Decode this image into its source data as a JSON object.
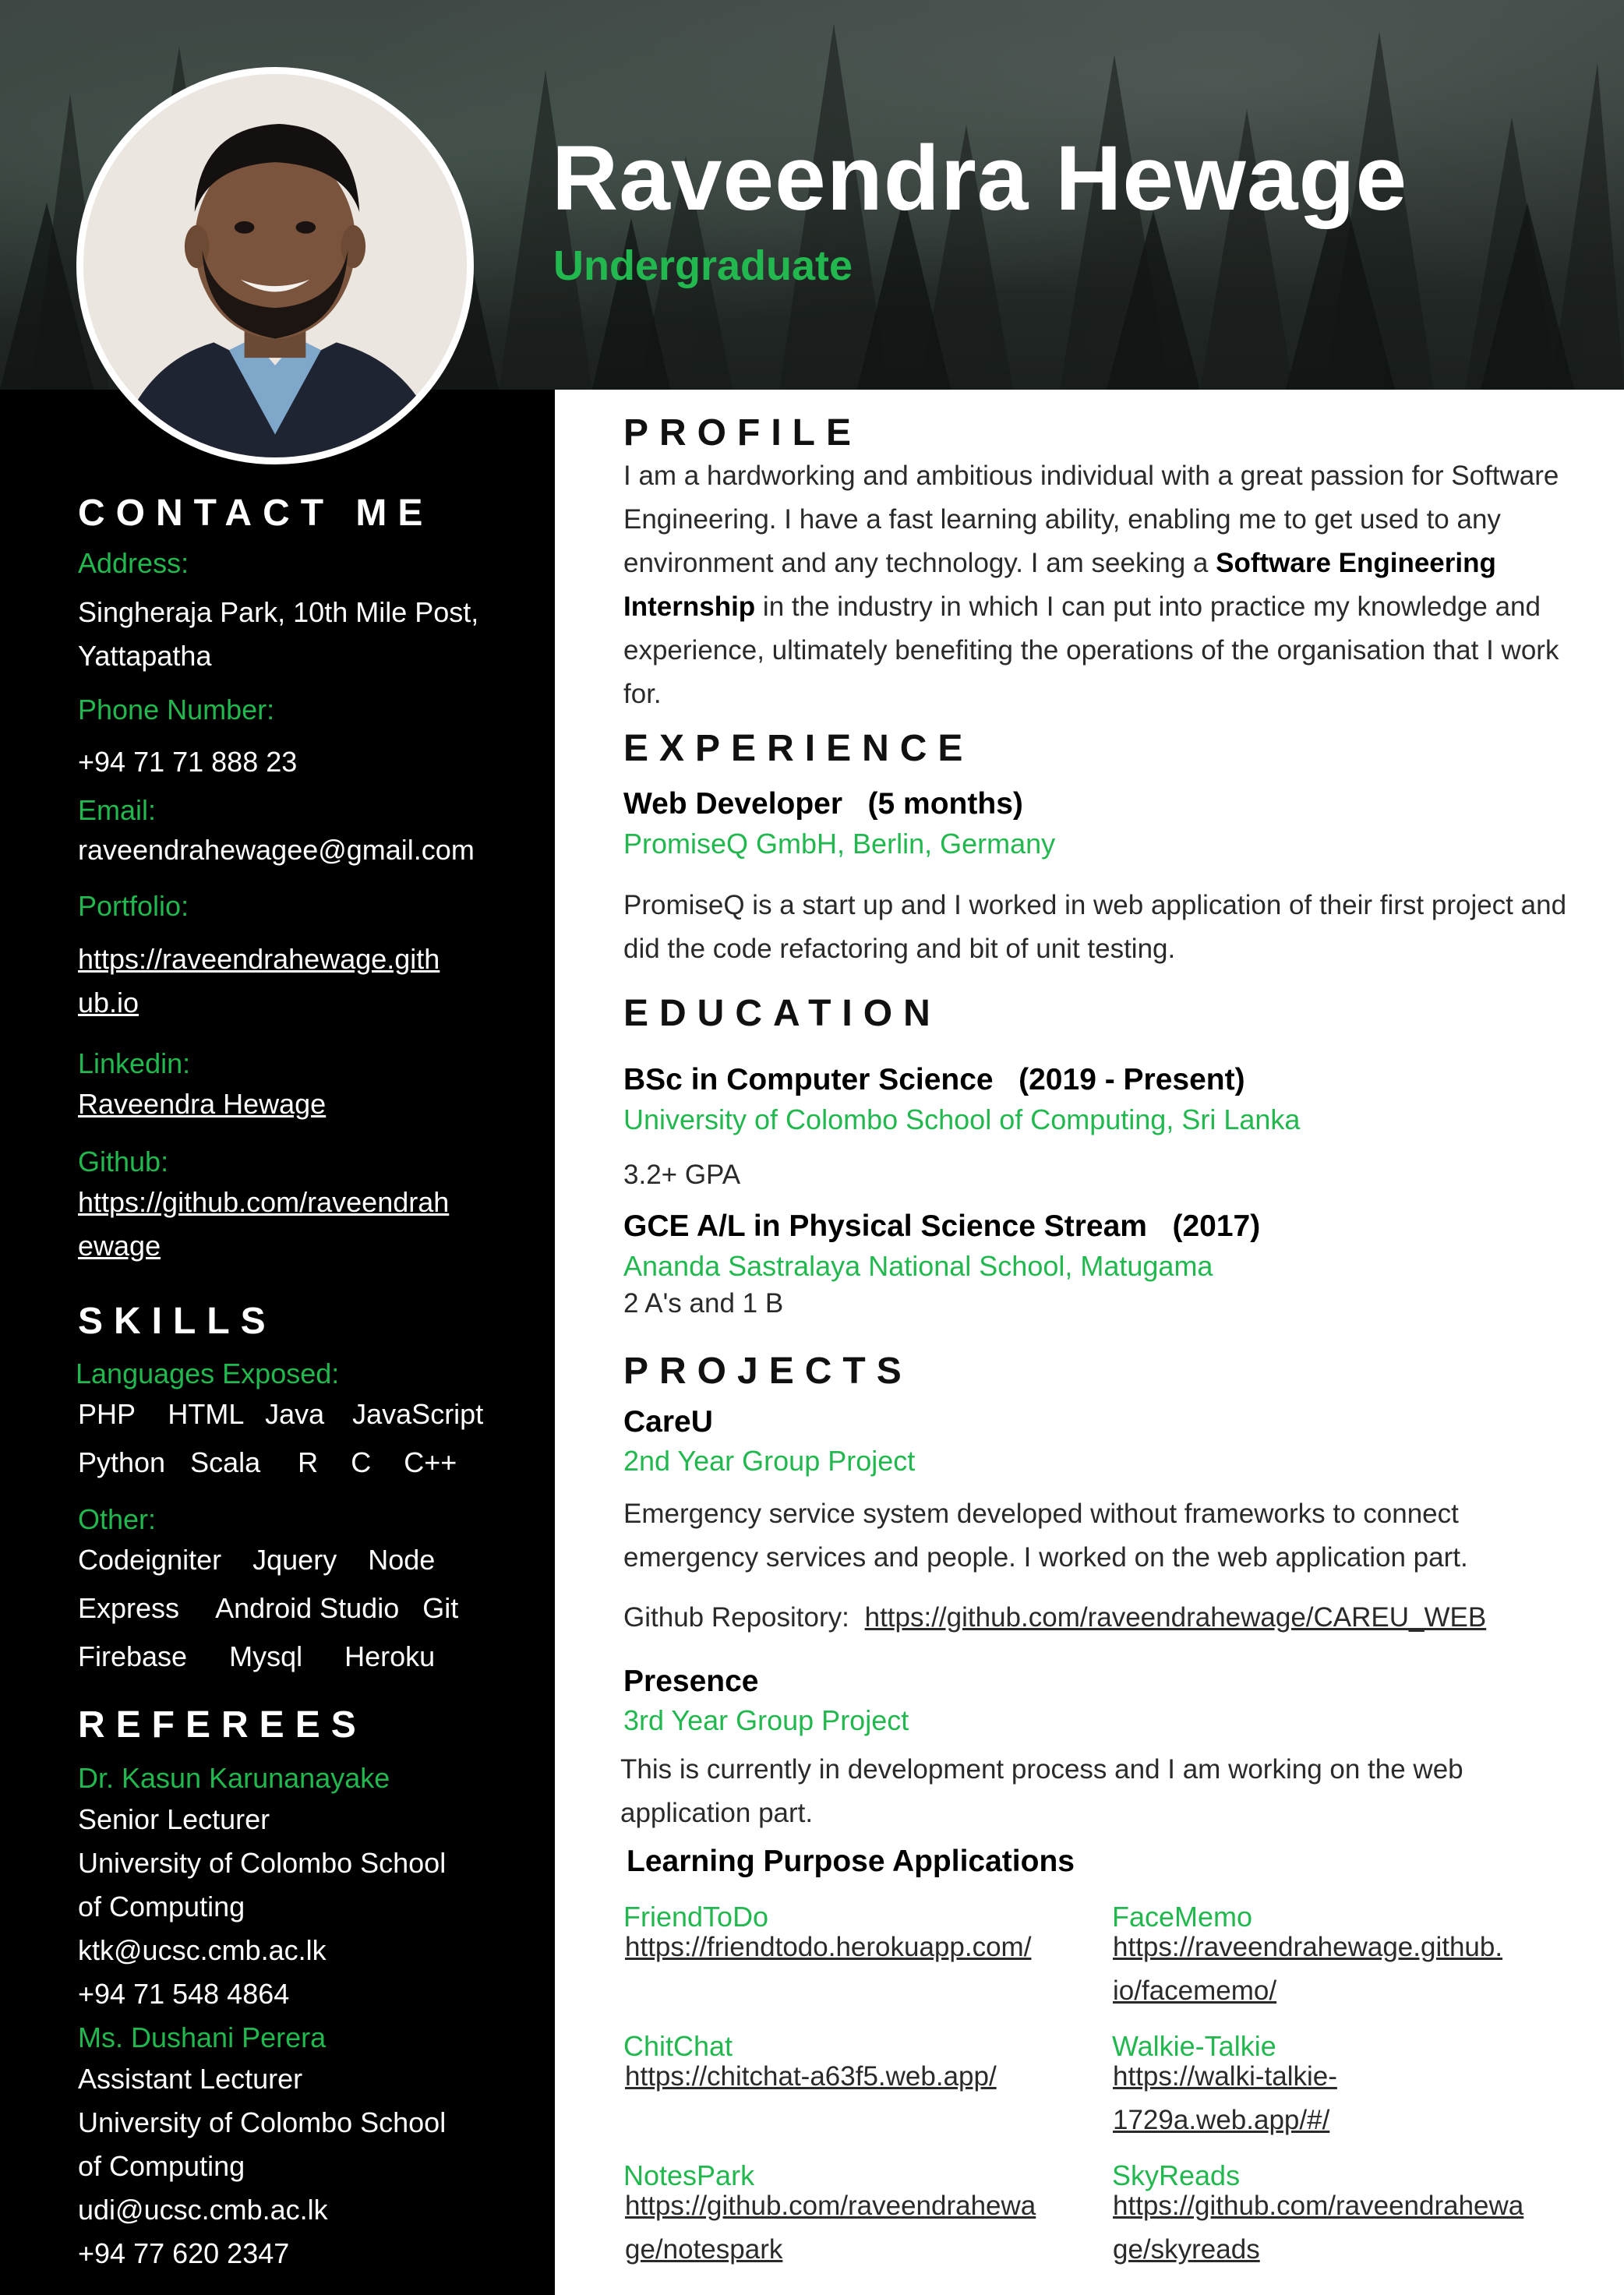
{
  "header": {
    "name": "Raveendra Hewage",
    "role": "Undergraduate"
  },
  "colors": {
    "accent": "#22b84f",
    "sidebar": "#000000",
    "header": "#2a312e"
  },
  "contact": {
    "heading": "CONTACT ME",
    "address_label": "Address:",
    "address_lines": [
      "Singheraja Park, 10th Mile Post,",
      "Yattapatha"
    ],
    "phone_label": "Phone Number:",
    "phone": "+94 71 71 888 23",
    "email_label": "Email:",
    "email": "raveendrahewagee@gmail.com",
    "portfolio_label": "Portfolio:",
    "portfolio_lines": [
      "https://raveendrahewage.gith",
      "ub.io"
    ],
    "linkedin_label": "Linkedin:",
    "linkedin": "Raveendra Hewage",
    "github_label": "Github:",
    "github_lines": [
      "https://github.com/raveendrah",
      "ewage"
    ]
  },
  "skills": {
    "heading": "SKILLS",
    "languages_label": "Languages Exposed:",
    "languages_row1": [
      "PHP",
      "HTML",
      "Java",
      "JavaScript"
    ],
    "languages_row2": [
      "Python",
      "Scala",
      "R",
      "C",
      "C++"
    ],
    "other_label": "Other:",
    "other_row1": [
      "Codeigniter",
      "Jquery",
      "Node"
    ],
    "other_row2": [
      "Express",
      "Android Studio",
      "Git"
    ],
    "other_row3": [
      "Firebase",
      "Mysql",
      "Heroku"
    ]
  },
  "referees": {
    "heading": "REFEREES",
    "items": [
      {
        "name": "Dr. Kasun Karunanayake",
        "lines": [
          "Senior Lecturer",
          "University of Colombo School",
          "of Computing",
          "ktk@ucsc.cmb.ac.lk",
          "+94 71 548 4864"
        ]
      },
      {
        "name": "Ms. Dushani Perera",
        "lines": [
          "Assistant Lecturer",
          "University of Colombo School",
          "of Computing",
          "udi@ucsc.cmb.ac.lk",
          "+94 77 620 2347"
        ]
      }
    ]
  },
  "profile": {
    "heading": "PROFILE",
    "text_before": "I am a hardworking and ambitious individual with a great passion for Software Engineering. I have a fast learning ability, enabling me to get used to any environment and any technology. I am seeking a ",
    "highlight": "Software Engineering Internship",
    "text_after": " in the industry in which I can put into practice my knowledge and experience, ultimately benefiting the operations of the organisation that I work for."
  },
  "experience": {
    "heading": "EXPERIENCE",
    "title": "Web Developer   (5 months)",
    "company": "PromiseQ GmbH, Berlin, Germany",
    "description": "PromiseQ is a start up and I worked in web application of their first project and did the code refactoring and bit of unit testing."
  },
  "education": {
    "heading": "EDUCATION",
    "items": [
      {
        "title": "BSc in Computer Science   (2019 - Present)",
        "school": "University of Colombo School of Computing, Sri Lanka",
        "detail": "3.2+ GPA"
      },
      {
        "title": "GCE A/L in Physical Science Stream   (2017)",
        "school": "Ananda Sastralaya National School, Matugama",
        "detail": "2 A's and 1 B"
      }
    ]
  },
  "projects": {
    "heading": "PROJECTS",
    "careu": {
      "title": "CareU",
      "subtitle": "2nd Year Group Project",
      "description": "Emergency service system developed without frameworks to connect emergency services and people. I worked on the web application part.",
      "repo_label": "Github Repository:",
      "repo_link": "https://github.com/raveendrahewage/CAREU_WEB"
    },
    "presence": {
      "title": "Presence",
      "subtitle": "3rd Year Group Project",
      "description": "This is currently in development process and I am working on the web application part."
    },
    "learning_heading": "Learning Purpose Applications",
    "apps": [
      {
        "name": "FriendToDo",
        "link_lines": [
          "https://friendtodo.herokuapp.com/"
        ]
      },
      {
        "name": "FaceMemo",
        "link_lines": [
          "https://raveendrahewage.github.",
          "io/facememo/"
        ]
      },
      {
        "name": "ChitChat",
        "link_lines": [
          "https://chitchat-a63f5.web.app/"
        ]
      },
      {
        "name": "Walkie-Talkie",
        "link_lines": [
          "https://walki-talkie-",
          "1729a.web.app/#/"
        ]
      },
      {
        "name": "NotesPark",
        "link_lines": [
          "https://github.com/raveendrahewa",
          "ge/notespark"
        ]
      },
      {
        "name": "SkyReads",
        "link_lines": [
          "https://github.com/raveendrahewa",
          "ge/skyreads"
        ]
      }
    ]
  }
}
